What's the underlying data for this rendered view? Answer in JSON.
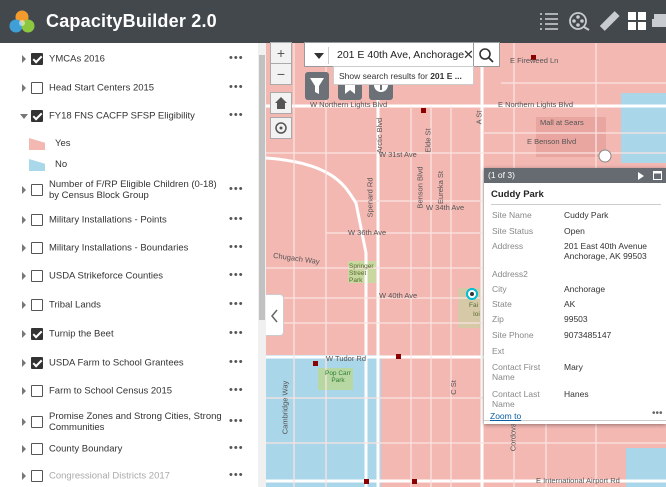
{
  "app": {
    "title": "CapacityBuilder 2.0"
  },
  "toolbar": {
    "icons": [
      "list-icon",
      "film-reel-icon",
      "ruler-icon",
      "grid-icon",
      "printer-icon"
    ]
  },
  "layers": [
    {
      "label": "YMCAs 2016",
      "checked": true,
      "expanded": false
    },
    {
      "label": "Head Start Centers 2015",
      "checked": false,
      "expanded": false
    },
    {
      "label": "FY18 FNS CACFP SFSP Eligibility",
      "checked": true,
      "expanded": true
    },
    {
      "label": "Number of F/RP Eligible Children (0-18) by Census Block Group",
      "checked": false,
      "expanded": false
    },
    {
      "label": "Military Installations - Points",
      "checked": false,
      "expanded": false
    },
    {
      "label": "Military Installations - Boundaries",
      "checked": false,
      "expanded": false
    },
    {
      "label": "USDA Strikeforce Counties",
      "checked": false,
      "expanded": false
    },
    {
      "label": "Tribal Lands",
      "checked": false,
      "expanded": false
    },
    {
      "label": "Turnip the Beet",
      "checked": true,
      "expanded": false
    },
    {
      "label": "USDA Farm to School Grantees",
      "checked": true,
      "expanded": false
    },
    {
      "label": "Farm to School Census 2015",
      "checked": false,
      "expanded": false
    },
    {
      "label": "Promise Zones and Strong Cities, Strong Communities",
      "checked": false,
      "expanded": false
    },
    {
      "label": "County Boundary",
      "checked": false,
      "expanded": false
    },
    {
      "label": "Congressional Districts 2017",
      "checked": false,
      "expanded": false
    }
  ],
  "legend": [
    {
      "label": "Yes",
      "color": "#f4b8b3"
    },
    {
      "label": "No",
      "color": "#a8d8ea"
    }
  ],
  "more_label": "•••",
  "search": {
    "value": "201 E 40th Ave, Anchorage",
    "clear": "✕",
    "suggest_prefix": "Show search results for ",
    "suggest_bold": "201 E ..."
  },
  "map_labels": [
    {
      "text": "E Fireweed Ln"
    },
    {
      "text": "W Northern Lights Blvd"
    },
    {
      "text": "E Northern Lights Blvd"
    },
    {
      "text": "Mall at Sears"
    },
    {
      "text": "E Benson Blvd"
    },
    {
      "text": "W 31st Ave"
    },
    {
      "text": "W 34th Ave"
    },
    {
      "text": "W 36th Ave"
    },
    {
      "text": "Chugach Way"
    },
    {
      "text": "Springer Street Park"
    },
    {
      "text": "W 40th Ave"
    },
    {
      "text": "W Tudor Rd"
    },
    {
      "text": "Pop Carr Park"
    },
    {
      "text": "Cambridge Way"
    },
    {
      "text": "C St"
    },
    {
      "text": "Cordova St"
    },
    {
      "text": "E International Airport Rd"
    },
    {
      "text": "Arctic Blvd"
    },
    {
      "text": "Spenard Rd"
    },
    {
      "text": "Benson Blvd"
    },
    {
      "text": "Eureka St"
    },
    {
      "text": "Elde St"
    },
    {
      "text": "A St"
    },
    {
      "text": "Fai"
    },
    {
      "text": "Ioi"
    }
  ],
  "popup": {
    "count": "(1 of 3)",
    "title": "Cuddy Park",
    "fields": [
      {
        "name": "Site Name",
        "value": "Cuddy Park"
      },
      {
        "name": "Site Status",
        "value": "Open"
      },
      {
        "name": "Address",
        "value": "201 East 40th Avenue Anchorage, AK 99503"
      },
      {
        "name": "Address2",
        "value": ""
      },
      {
        "name": "City",
        "value": "Anchorage"
      },
      {
        "name": "State",
        "value": "AK"
      },
      {
        "name": "Zip",
        "value": "99503"
      },
      {
        "name": "Site Phone",
        "value": "9073485147"
      },
      {
        "name": "Ext",
        "value": ""
      },
      {
        "name": "Contact First Name",
        "value": "Mary"
      },
      {
        "name": "Contact Last Name",
        "value": "Hanes"
      }
    ],
    "zoom_label": "Zoom to",
    "more": "•••"
  },
  "map_controls": {
    "zoom_in": "+",
    "zoom_out": "−"
  }
}
